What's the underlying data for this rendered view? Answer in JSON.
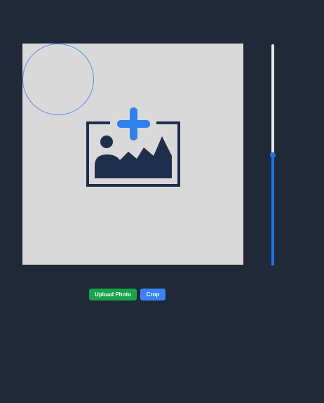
{
  "crop_area": {
    "background_color": "#d9d9d9",
    "selection_shape": "circle",
    "selection_color": "#5b8def",
    "placeholder_icon": "add-photo-icon",
    "placeholder_colors": {
      "frame": "#1e2f4d",
      "plus": "#2f80ed"
    }
  },
  "zoom_slider": {
    "orientation": "vertical",
    "value_fraction": 0.5,
    "track_color": "#e5e7eb",
    "fill_color": "#1a73e8"
  },
  "toolbar": {
    "upload_label": "Upload Photo",
    "upload_color": "#16a34a",
    "crop_label": "Crop",
    "crop_color": "#3b82f6"
  },
  "page": {
    "background_color": "#1f2937"
  }
}
